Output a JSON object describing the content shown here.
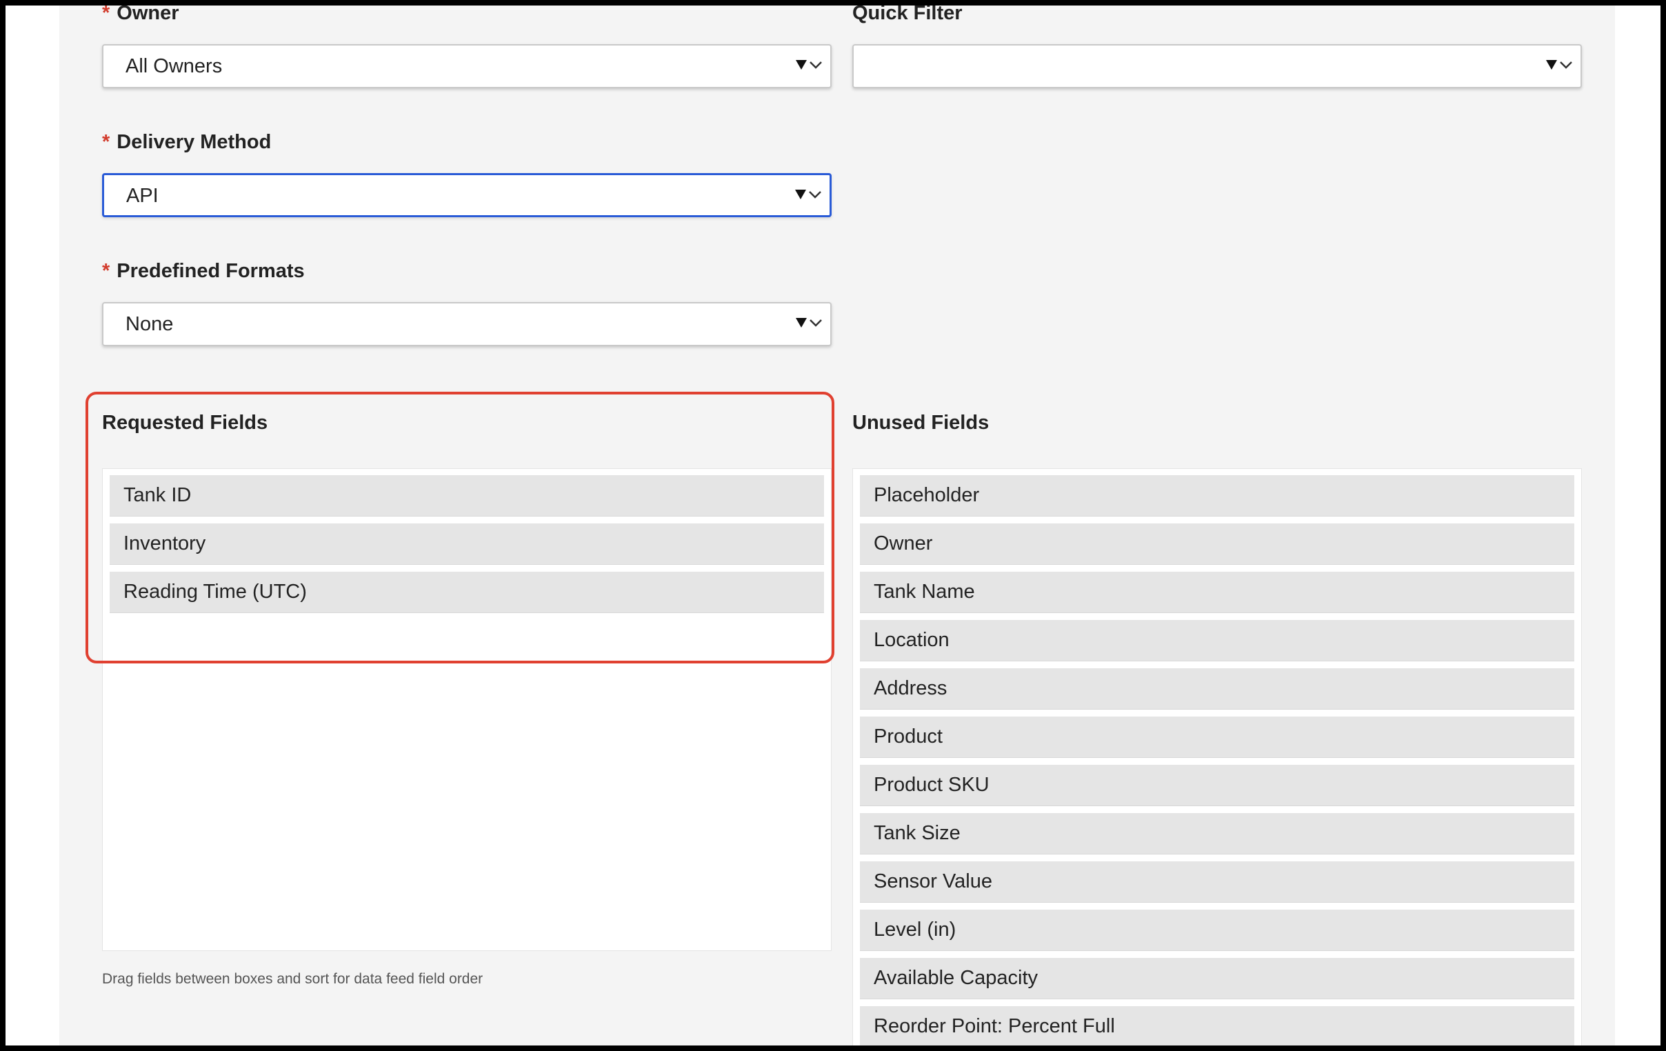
{
  "owner_field": {
    "label": "Owner",
    "value": "All Owners"
  },
  "quick_filter_field": {
    "label": "Quick Filter",
    "value": ""
  },
  "delivery_method_field": {
    "label": "Delivery Method",
    "value": "API"
  },
  "predefined_formats_field": {
    "label": "Predefined Formats",
    "value": "None"
  },
  "required_marker": "*",
  "requested_fields": {
    "title": "Requested Fields",
    "items": [
      "Tank ID",
      "Inventory",
      "Reading Time (UTC)"
    ]
  },
  "unused_fields": {
    "title": "Unused Fields",
    "items": [
      "Placeholder",
      "Owner",
      "Tank Name",
      "Location",
      "Address",
      "Product",
      "Product SKU",
      "Tank Size",
      "Sensor Value",
      "Level (in)",
      "Available Capacity",
      "Reorder Point: Percent Full"
    ]
  },
  "hint_text": "Drag fields between boxes and sort for data feed field order",
  "colors": {
    "required_asterisk": "#d23b2c",
    "focus_border": "#2a5bd7",
    "highlight_outline": "#e04030",
    "panel_background": "#f4f4f4",
    "field_item_background": "#e5e5e5"
  }
}
